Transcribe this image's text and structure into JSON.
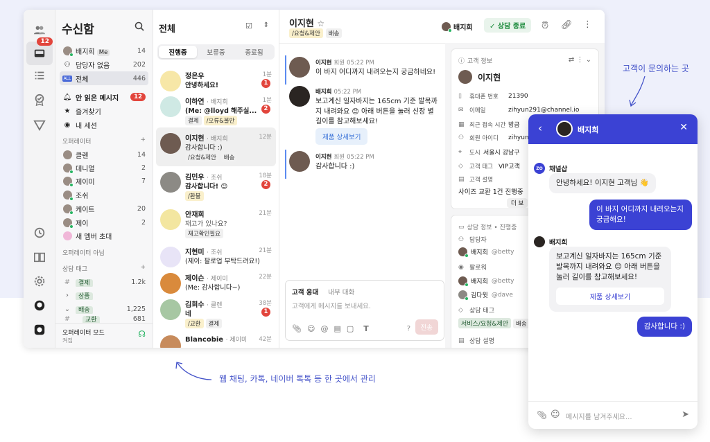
{
  "inbox": {
    "title": "수신함",
    "items": [
      {
        "label": "배지희",
        "suffix": "Me",
        "count": "14"
      },
      {
        "label": "담당자 없음",
        "count": "202"
      },
      {
        "label": "전체",
        "count": "446"
      },
      {
        "label": "안 읽은 메시지",
        "count": "12"
      },
      {
        "label": "즐겨찾기"
      },
      {
        "label": "내 세션"
      }
    ],
    "operators_label": "오퍼레이터",
    "operators": [
      {
        "name": "클렌",
        "count": "14"
      },
      {
        "name": "데니얼",
        "count": "2"
      },
      {
        "name": "제이미",
        "count": "7"
      },
      {
        "name": "조쉬",
        "count": ""
      },
      {
        "name": "케이트",
        "count": "20"
      },
      {
        "name": "제이",
        "count": "2"
      },
      {
        "name": "새 멤버 초대",
        "count": ""
      }
    ],
    "non_operator_label": "오퍼레이터 아님",
    "tags_label": "상담 태그",
    "tags": [
      {
        "name": "결제",
        "count": "1.2k"
      },
      {
        "name": "상품",
        "count": ""
      },
      {
        "name": "배송",
        "count": "1,225"
      },
      {
        "name": "교환",
        "count": "681"
      }
    ],
    "mode_label": "오퍼레이터 모드",
    "mode_value": "켜짐"
  },
  "rail": {
    "badge": "12"
  },
  "list": {
    "title": "전체",
    "tabs": [
      "진행중",
      "보류중",
      "종료됨"
    ],
    "items": [
      {
        "name": "정은우",
        "manager": "",
        "time": "1분",
        "message": "안녕하세요!",
        "unread": "1",
        "tags": []
      },
      {
        "name": "이하연",
        "manager": "· 배지희",
        "time": "1분",
        "message": "(Me: @lloyd 해주실...",
        "unread": "2",
        "tags": [
          "결제",
          "/오류&불만"
        ]
      },
      {
        "name": "이지현",
        "manager": "· 배지희",
        "time": "12분",
        "message": "감사합니다 :)",
        "unread": "",
        "tags": [
          "/요청&제안",
          "배송"
        ]
      },
      {
        "name": "김민우",
        "manager": "· 조쉬",
        "time": "18분",
        "message": "감사합니다! 😊",
        "unread": "2",
        "tags": [
          "/환불"
        ]
      },
      {
        "name": "안재희",
        "manager": "",
        "time": "21분",
        "message": "재고가 있나요?",
        "unread": "",
        "tags": [
          "재고확인필요"
        ]
      },
      {
        "name": "지현미",
        "manager": "· 조쉬",
        "time": "21분",
        "message": "(제이: 팔로업 부탁드려요!)",
        "unread": "",
        "tags": []
      },
      {
        "name": "제이슨",
        "manager": "· 제이미",
        "time": "22분",
        "message": "(Me: 감사합니다~)",
        "unread": "",
        "tags": []
      },
      {
        "name": "김희수",
        "manager": "· 클렌",
        "time": "38분",
        "message": "네",
        "unread": "1",
        "tags": [
          "/교환",
          "결제"
        ]
      },
      {
        "name": "Blancobie",
        "manager": "· 제이미",
        "time": "42분",
        "message": "",
        "unread": "",
        "tags": []
      }
    ]
  },
  "chat": {
    "title": "이지현",
    "tags": [
      "/요청&제안",
      "배송"
    ],
    "assignee": "배지희",
    "end_button": "상담 종료",
    "messages": [
      {
        "name": "이지현",
        "role": "회원",
        "time": "05:22 PM",
        "text": "이 바지 어디까지 내려오는지 궁금하네요!"
      },
      {
        "name": "배지희",
        "role": "",
        "time": "05:22 PM",
        "text": "보고계신 일자바지는 165cm 기준 발목까지 내려와요 😊 아래 버튼을 눌러 신장 별 길이를 참고해보세요!"
      },
      {
        "name": "이지현",
        "role": "회원",
        "time": "05:22 PM",
        "text": "감사합니다 :)"
      }
    ],
    "product_button": "제품 상세보기",
    "composer_tabs": [
      "고객 응대",
      "내부 대화"
    ],
    "composer_placeholder": "고객에게 메시지를 보내세요.",
    "send_label": "전송"
  },
  "customer": {
    "section_title": "고객 정보",
    "name": "이지현",
    "fields": [
      {
        "key": "휴대폰 번호",
        "value": "21390"
      },
      {
        "key": "이메일",
        "value": "zihyun291@channel.io"
      },
      {
        "key": "최근 접속 시간",
        "value": "방금"
      },
      {
        "key": "회원 아이디",
        "value": "zihyun"
      },
      {
        "key": "도시",
        "value": "서울시 강남구"
      },
      {
        "key": "고객 태그",
        "value": "VIP고객"
      },
      {
        "key": "고객 설명",
        "value": ""
      }
    ],
    "description": "사이즈 교환 1건 진행중",
    "more_button": "더 보",
    "session_title": "상담 정보 • 진행중",
    "assignee_label": "담당자",
    "assignee": "배지희",
    "assignee_handle": "@betty",
    "followers_label": "팔로워",
    "followers": [
      {
        "name": "배지희",
        "handle": "@betty"
      },
      {
        "name": "김다윗",
        "handle": "@dave"
      }
    ],
    "session_tags_label": "상담 태그",
    "session_tags": [
      "서비스/요청&제안",
      "배송"
    ],
    "session_desc_label": "상담 설명"
  },
  "widget": {
    "header_name": "배지희",
    "channel_name": "채널삽",
    "bubble1": "안녕하세요! 이지현 고객님 👋",
    "bubble2": "이 바지 어디까지 내려오는지 궁금해요!",
    "agent_name": "배지희",
    "bubble3": "보고계신 일자바지는 165cm 기준 발목까지 내려와요 😊 아래 버튼을 눌러 길이를 참고해보세요!",
    "product_button": "제품 상세보기",
    "bubble4": "감사합니다 :)",
    "placeholder": "메시지를 남겨주세요..."
  },
  "annotations": {
    "right": "고객이 문의하는 곳",
    "bottom": "웹 채팅, 카톡, 네이버 톡톡 등 한 곳에서 관리"
  },
  "colors": {
    "brand": "#3b42d4",
    "unread": "#e2453c",
    "online": "#28b463"
  }
}
